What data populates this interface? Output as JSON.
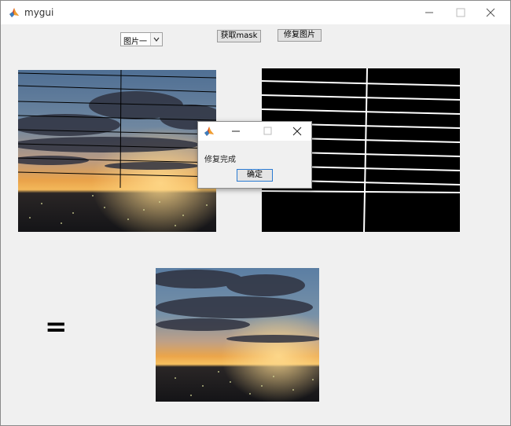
{
  "window": {
    "title": "mygui",
    "icon": "matlab-icon"
  },
  "controls": {
    "image_select": {
      "selected": "图片一",
      "icon": "chevron-down-icon"
    },
    "get_mask_label": "获取mask",
    "repair_label": "修复图片"
  },
  "images": {
    "source": "sunset city skyline with thin black line scratches",
    "mask": "black mask with white scratch lines",
    "result": "repaired sunset city skyline"
  },
  "equals_sign": "=",
  "dialog": {
    "message": "修复完成",
    "ok_label": "确定"
  },
  "colors": {
    "window_bg": "#f0f0f0",
    "titlebar_bg": "#ffffff",
    "dialog_button_border": "#2a7ad2"
  }
}
